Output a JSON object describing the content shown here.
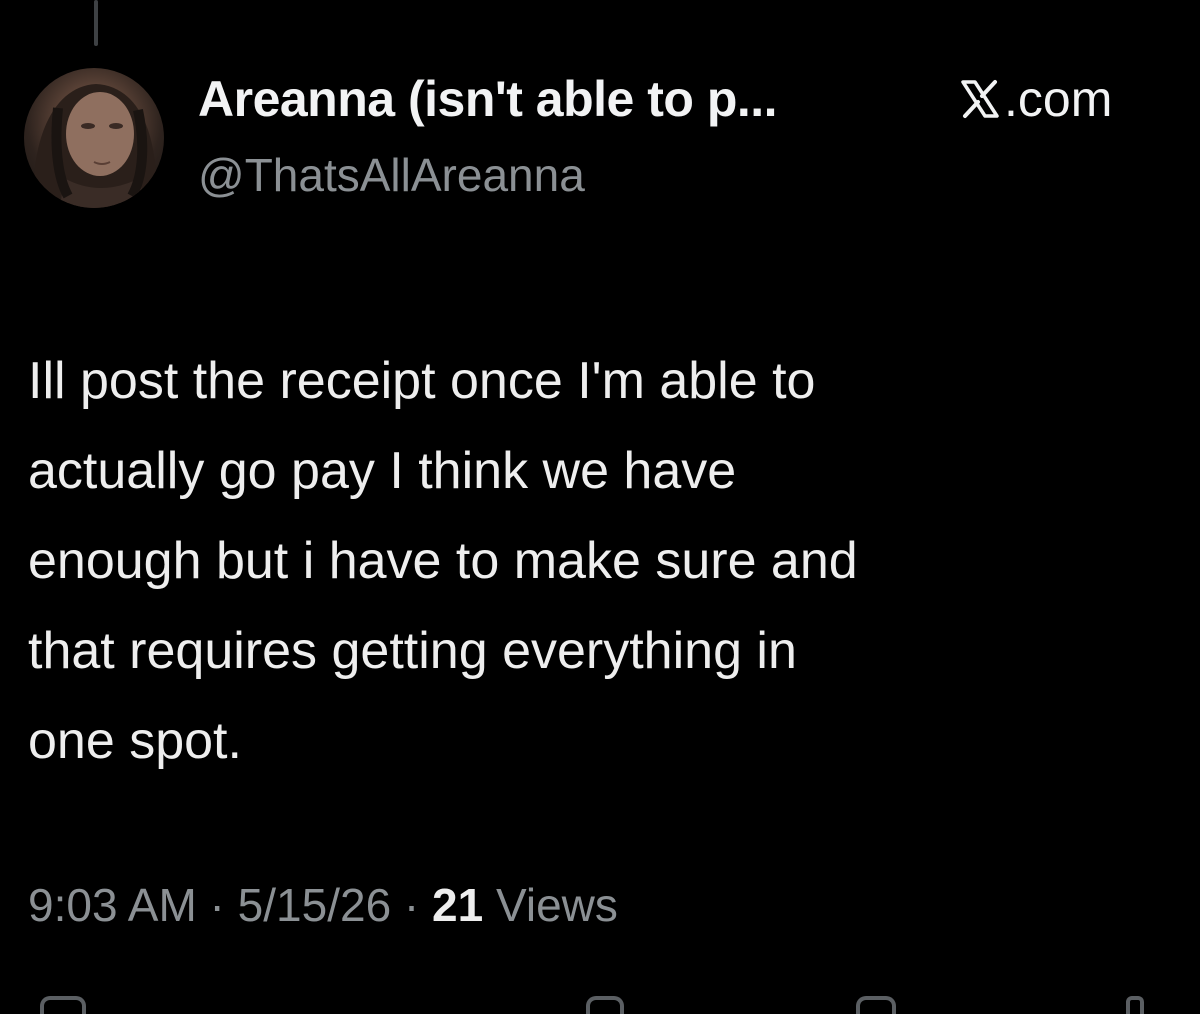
{
  "author": {
    "display_name": "Areanna (isn't able to p...",
    "handle": "@ThatsAllAreanna",
    "avatar_icon": "profile-photo"
  },
  "source": {
    "icon": "x-logo-icon",
    "label": ".com"
  },
  "tweet": {
    "text": "Ill post the receipt once I'm able to\nactually go pay I think we have\nenough but i have to make sure and\nthat requires getting everything in\none spot."
  },
  "meta": {
    "time": "9:03 AM",
    "separator": " · ",
    "date": "5/15/26",
    "views_count": "21",
    "views_label": " Views"
  },
  "colors": {
    "background": "#000000",
    "primary_text": "#e7e9ea",
    "secondary_text": "#8b9094"
  }
}
